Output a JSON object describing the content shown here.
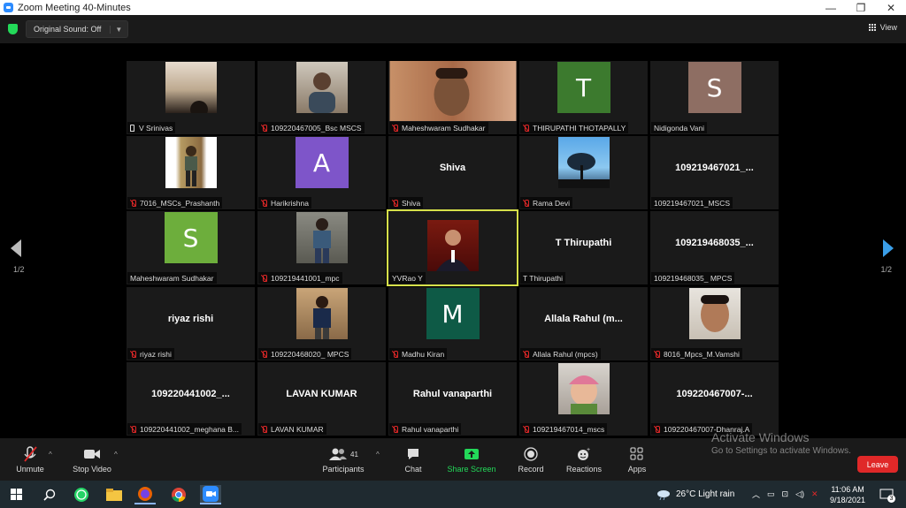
{
  "window": {
    "title": "Zoom Meeting 40-Minutes",
    "minimize": "—",
    "restore": "❐",
    "close": "✕"
  },
  "topbar": {
    "sound_label": "Original Sound: Off",
    "view_label": "View"
  },
  "pager": {
    "left": "1/2",
    "right": "1/2"
  },
  "tiles": [
    {
      "label": "V Srinivas",
      "icon": "pin"
    },
    {
      "label": "109220467005_Bsc MSCS",
      "icon": "mute"
    },
    {
      "label": "Maheshwaram Sudhakar",
      "icon": "mute"
    },
    {
      "label": "THIRUPATHI THOTAPALLY",
      "icon": "mute",
      "letter": "T",
      "color": "#3C7A2E"
    },
    {
      "label": "Nidigonda Vani",
      "icon": "none",
      "letter": "S",
      "color": "#8E6E63"
    },
    {
      "label": "7016_MSCs_Prashanth",
      "icon": "mute"
    },
    {
      "label": "Harikrishna",
      "icon": "mute",
      "letter": "A",
      "color": "#7E55C9"
    },
    {
      "label": "Shiva",
      "icon": "mute",
      "bigname": "Shiva"
    },
    {
      "label": "Rama Devi",
      "icon": "mute"
    },
    {
      "label": "109219467021_MSCS",
      "icon": "none",
      "bigname": "109219467021_..."
    },
    {
      "label": "Maheshwaram Sudhakar",
      "icon": "none",
      "letter": "S",
      "color": "#6DAE3C"
    },
    {
      "label": "109219441001_mpc",
      "icon": "mute"
    },
    {
      "label": "YVRao Y",
      "icon": "none"
    },
    {
      "label": "T Thirupathi",
      "icon": "none",
      "bigname": "T Thirupathi"
    },
    {
      "label": "109219468035_ MPCS",
      "icon": "none",
      "bigname": "109219468035_..."
    },
    {
      "label": "riyaz rishi",
      "icon": "mute",
      "bigname": "riyaz rishi"
    },
    {
      "label": "109220468020_ MPCS",
      "icon": "mute"
    },
    {
      "label": "Madhu Kiran",
      "icon": "mute",
      "letter": "M",
      "color": "#0E5A46"
    },
    {
      "label": "Allala Rahul (mpcs)",
      "icon": "mute",
      "bigname": "Allala Rahul (m..."
    },
    {
      "label": "8016_Mpcs_M.Vamshi",
      "icon": "mute"
    },
    {
      "label": "109220441002_meghana B...",
      "icon": "mute",
      "bigname": "109220441002_..."
    },
    {
      "label": "LAVAN KUMAR",
      "icon": "mute",
      "bigname": "LAVAN KUMAR"
    },
    {
      "label": "Rahul vanaparthi",
      "icon": "mute",
      "bigname": "Rahul vanaparthi"
    },
    {
      "label": "109219467014_mscs",
      "icon": "mute"
    },
    {
      "label": "109220467007-Dhanraj.A",
      "icon": "mute",
      "bigname": "109220467007-..."
    }
  ],
  "toolbar": {
    "unmute": "Unmute",
    "stop_video": "Stop Video",
    "participants": "Participants",
    "participant_count": "41",
    "chat": "Chat",
    "share_screen": "Share Screen",
    "record": "Record",
    "reactions": "Reactions",
    "apps": "Apps",
    "leave": "Leave"
  },
  "watermark": {
    "line1": "Activate Windows",
    "line2": "Go to Settings to activate Windows."
  },
  "taskbar": {
    "weather": "26°C  Light rain",
    "time": "11:06 AM",
    "date": "9/18/2021",
    "notifications": "3"
  }
}
